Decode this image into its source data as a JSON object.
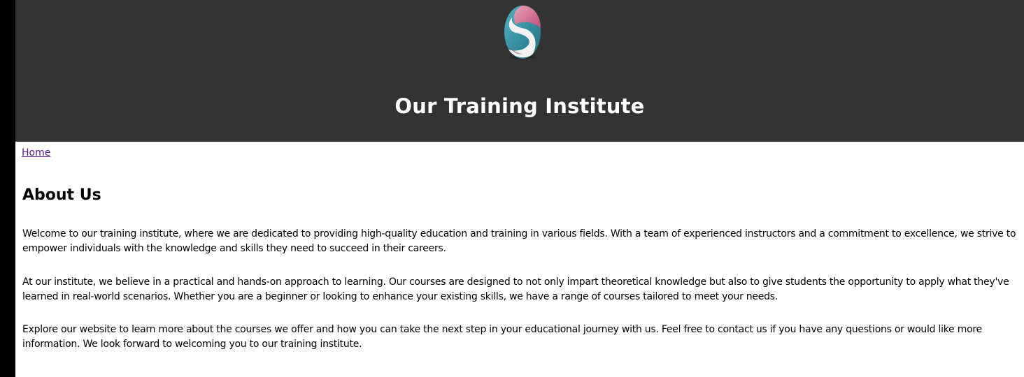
{
  "header": {
    "logo_icon": "swirl-s-logo",
    "title": "Our Training Institute",
    "background": "#333333"
  },
  "nav": {
    "home_label": "Home"
  },
  "about": {
    "heading": "About Us",
    "paragraphs": [
      "Welcome to our training institute, where we are dedicated to providing high-quality education and training in various fields. With a team of experienced instructors and a commitment to excellence, we strive to empower individuals with the knowledge and skills they need to succeed in their careers.",
      "At our institute, we believe in a practical and hands-on approach to learning. Our courses are designed to not only impart theoretical knowledge but also to give students the opportunity to apply what they've learned in real-world scenarios. Whether you are a beginner or looking to enhance your existing skills, we have a range of courses tailored to meet your needs.",
      "Explore our website to learn more about the courses we offer and how you can take the next step in your educational journey with us. Feel free to contact us if you have any questions or would like more information. We look forward to welcoming you to our training institute."
    ]
  }
}
